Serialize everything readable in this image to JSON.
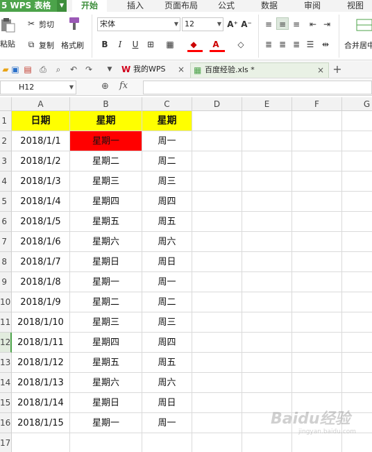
{
  "app": {
    "name": "5 WPS 表格"
  },
  "menu": {
    "tabs": [
      "开始",
      "插入",
      "页面布局",
      "公式",
      "数据",
      "审阅",
      "视图"
    ],
    "active": "开始"
  },
  "ribbon": {
    "paste": "粘贴",
    "cut": "剪切",
    "copy": "复制",
    "format_painter": "格式刷",
    "font_name": "宋体",
    "font_size": "12",
    "merge_center": "合并居中"
  },
  "quickbar": {
    "tabs": [
      {
        "label": "我的WPS"
      },
      {
        "label": "百度经验.xls *"
      }
    ]
  },
  "formula_bar": {
    "name_box": "H12",
    "fx": "fx",
    "value": ""
  },
  "sheet": {
    "columns": [
      "A",
      "B",
      "C",
      "D",
      "E",
      "F",
      "G"
    ],
    "rows": [
      "1",
      "2",
      "3",
      "4",
      "5",
      "6",
      "7",
      "8",
      "9",
      "10",
      "11",
      "12",
      "13",
      "14",
      "15",
      "16",
      "17"
    ],
    "header": [
      "日期",
      "星期",
      "星期"
    ],
    "data": [
      [
        "2018/1/1",
        "星期一",
        "周一"
      ],
      [
        "2018/1/2",
        "星期二",
        "周二"
      ],
      [
        "2018/1/3",
        "星期三",
        "周三"
      ],
      [
        "2018/1/4",
        "星期四",
        "周四"
      ],
      [
        "2018/1/5",
        "星期五",
        "周五"
      ],
      [
        "2018/1/6",
        "星期六",
        "周六"
      ],
      [
        "2018/1/7",
        "星期日",
        "周日"
      ],
      [
        "2018/1/8",
        "星期一",
        "周一"
      ],
      [
        "2018/1/9",
        "星期二",
        "周二"
      ],
      [
        "2018/1/10",
        "星期三",
        "周三"
      ],
      [
        "2018/1/11",
        "星期四",
        "周四"
      ],
      [
        "2018/1/12",
        "星期五",
        "周五"
      ],
      [
        "2018/1/13",
        "星期六",
        "周六"
      ],
      [
        "2018/1/14",
        "星期日",
        "周日"
      ],
      [
        "2018/1/15",
        "星期一",
        "周一"
      ]
    ],
    "active_row": "12",
    "colors": {
      "header_fill": "#ffff00",
      "highlight_fill": "#ff0000"
    }
  },
  "watermark": {
    "text": "Baidu经验",
    "url": "jingyan.baidu.com"
  }
}
